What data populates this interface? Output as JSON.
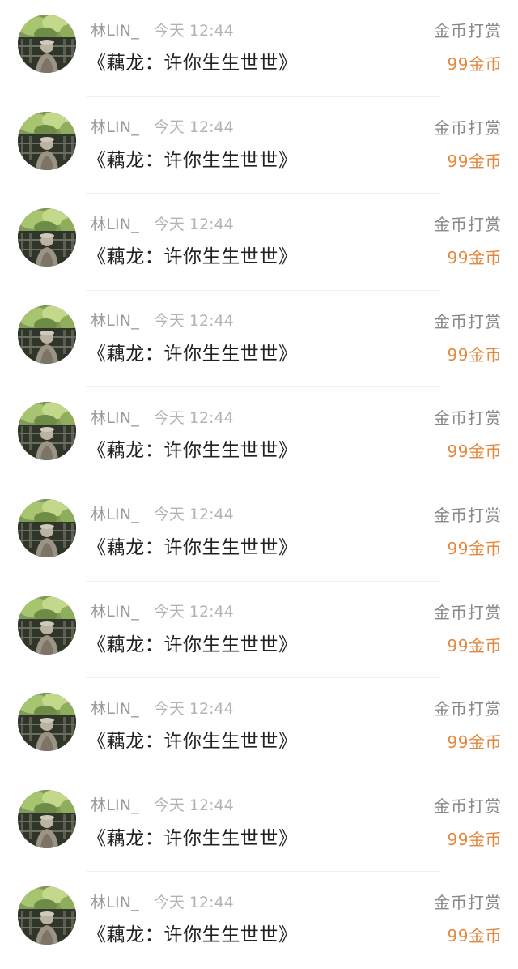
{
  "colors": {
    "username": "#999999",
    "time": "#b3b3b3",
    "title": "#222222",
    "type": "#888888",
    "amount": "#e3893f",
    "divider": "#f0f0f0"
  },
  "records": [
    {
      "avatar_icon": "user-avatar",
      "username": "林LIN_",
      "time": "今天 12:44",
      "title": "《藕龙：许你生生世世》",
      "type": "金币打赏",
      "amount": "99金币"
    },
    {
      "avatar_icon": "user-avatar",
      "username": "林LIN_",
      "time": "今天 12:44",
      "title": "《藕龙：许你生生世世》",
      "type": "金币打赏",
      "amount": "99金币"
    },
    {
      "avatar_icon": "user-avatar",
      "username": "林LIN_",
      "time": "今天 12:44",
      "title": "《藕龙：许你生生世世》",
      "type": "金币打赏",
      "amount": "99金币"
    },
    {
      "avatar_icon": "user-avatar",
      "username": "林LIN_",
      "time": "今天 12:44",
      "title": "《藕龙：许你生生世世》",
      "type": "金币打赏",
      "amount": "99金币"
    },
    {
      "avatar_icon": "user-avatar",
      "username": "林LIN_",
      "time": "今天 12:44",
      "title": "《藕龙：许你生生世世》",
      "type": "金币打赏",
      "amount": "99金币"
    },
    {
      "avatar_icon": "user-avatar",
      "username": "林LIN_",
      "time": "今天 12:44",
      "title": "《藕龙：许你生生世世》",
      "type": "金币打赏",
      "amount": "99金币"
    },
    {
      "avatar_icon": "user-avatar",
      "username": "林LIN_",
      "time": "今天 12:44",
      "title": "《藕龙：许你生生世世》",
      "type": "金币打赏",
      "amount": "99金币"
    },
    {
      "avatar_icon": "user-avatar",
      "username": "林LIN_",
      "time": "今天 12:44",
      "title": "《藕龙：许你生生世世》",
      "type": "金币打赏",
      "amount": "99金币"
    },
    {
      "avatar_icon": "user-avatar",
      "username": "林LIN_",
      "time": "今天 12:44",
      "title": "《藕龙：许你生生世世》",
      "type": "金币打赏",
      "amount": "99金币"
    },
    {
      "avatar_icon": "user-avatar",
      "username": "林LIN_",
      "time": "今天 12:44",
      "title": "《藕龙：许你生生世世》",
      "type": "金币打赏",
      "amount": "99金币"
    }
  ]
}
